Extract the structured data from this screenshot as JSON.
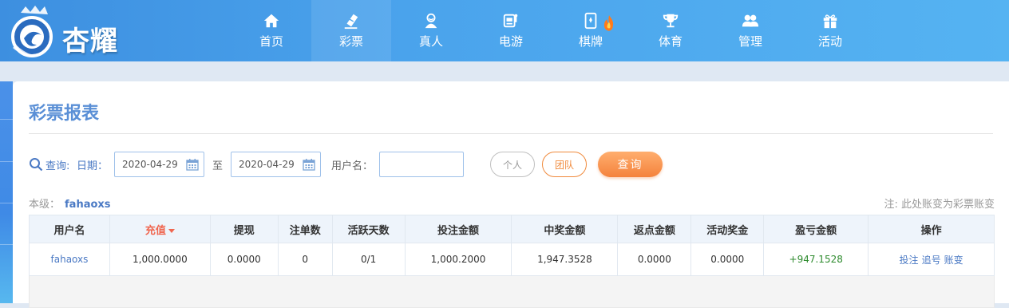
{
  "brand": {
    "logo_text": "杏耀"
  },
  "nav": [
    {
      "label": "首页",
      "icon": "home-icon"
    },
    {
      "label": "彩票",
      "icon": "ticket-icon"
    },
    {
      "label": "真人",
      "icon": "dealer-icon"
    },
    {
      "label": "电游",
      "icon": "slot-machine-icon"
    },
    {
      "label": "棋牌",
      "icon": "cards-icon"
    },
    {
      "label": "体育",
      "icon": "trophy-icon"
    },
    {
      "label": "管理",
      "icon": "users-icon"
    },
    {
      "label": "活动",
      "icon": "gift-icon"
    }
  ],
  "page": {
    "title": "彩票报表",
    "query": {
      "query_label": "查询:",
      "date_label": "日期：",
      "date_from": "2020-04-29",
      "to_label": "至",
      "date_to": "2020-04-29",
      "username_label": "用户名：",
      "username_value": "",
      "personal_label": "个人",
      "team_label": "团队",
      "search_label": "查询"
    },
    "level_label": "本级：",
    "level_user": "fahaoxs",
    "note": "注: 此处账变为彩票账变"
  },
  "table": {
    "headers": [
      "用户名",
      "充值",
      "提现",
      "注单数",
      "活跃天数",
      "投注金额",
      "中奖金额",
      "返点金额",
      "活动奖金",
      "盈亏金额",
      "操作"
    ],
    "rows": [
      {
        "username": "fahaoxs",
        "deposit": "1,000.0000",
        "withdraw": "0.0000",
        "orders": "0",
        "active_days": "0/1",
        "bet_amount": "1,000.2000",
        "win_amount": "1,947.3528",
        "rebate": "0.0000",
        "bonus": "0.0000",
        "profit": "+947.1528",
        "ops": [
          "投注",
          "追号",
          "账变"
        ]
      }
    ]
  },
  "colors": {
    "brand_blue": "#4aa3ec",
    "link_blue": "#4a79c4",
    "accent_orange": "#f4823c",
    "profit_green": "#2e8b2e",
    "sort_red": "#f0664f"
  }
}
